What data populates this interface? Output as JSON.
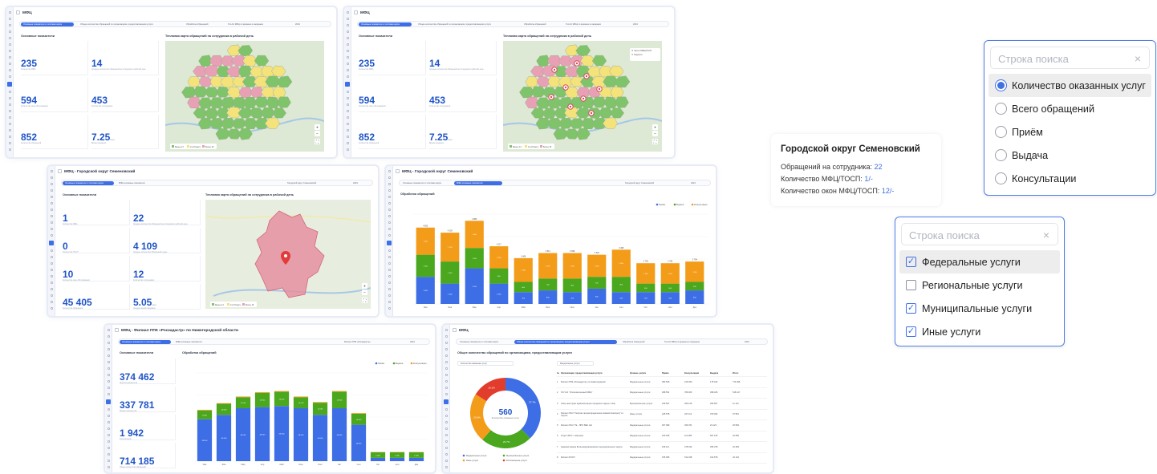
{
  "app_title": "МФЦ",
  "titles": {
    "semenovsky": "МФЦ - Городской округ Семеновский",
    "rosreestr": "МФЦ - Филиал ППК «Роскадастр» по Нижегородской области"
  },
  "tabs": {
    "main": "Основные показатели и тепловая карта",
    "services": "Общее количество обращений по организациям, предоставляющим услуги",
    "requests": "Обработка обращений",
    "top10": "Топ-10 МФЦ по времени в ожидании",
    "indicators": "МФЦ основные показатели",
    "year": "2024",
    "district": "Городской округ Семеновский",
    "branch": "Филиал ППК «Роскадастр»"
  },
  "section": {
    "indicators": "Основные показатели",
    "heatmap": "Тепловая карта обращений на сотрудника в рабочий день",
    "processing": "Обработка обращений",
    "services_total": "Общее количество обращений по организациям, предоставляющим услуги"
  },
  "kpi_region": [
    {
      "value": "235",
      "label": "Количество МФЦ"
    },
    {
      "value": "14",
      "label": "Среднее количество обращений на сотрудника в рабочий день"
    },
    {
      "value": "594",
      "label": "Количество окон обслуживания"
    },
    {
      "value": "453",
      "label": "Количество сотрудников"
    },
    {
      "value": "852",
      "label": "Количество обращений"
    },
    {
      "value": "7.25",
      "unit": "мин",
      "label": "Время ожидания"
    }
  ],
  "kpi_semenovsky": [
    {
      "value": "1",
      "label": "Количество МФЦ"
    },
    {
      "value": "22",
      "label": "Среднее количество обращений на сотрудника в рабочий день"
    },
    {
      "value": "0",
      "label": "Количество ТОСП"
    },
    {
      "value": "4 109",
      "label": "Среднее количество обращений в день"
    },
    {
      "value": "10",
      "label": "Количество окон обслуживания"
    },
    {
      "value": "12",
      "label": "Количество сотрудников"
    },
    {
      "value": "45 405",
      "label": "Количество обращений"
    },
    {
      "value": "5.05",
      "unit": "мин",
      "label": "Среднее время ожидания"
    }
  ],
  "kpi_rosreestr": [
    {
      "value": "374 462",
      "label": "Принято документов"
    },
    {
      "value": "337 781",
      "label": "Выдано документов"
    },
    {
      "value": "1 942",
      "label": "Консультации"
    },
    {
      "value": "714 185",
      "label": "Общее количество обращений"
    }
  ],
  "map_legend": [
    "Менее 13",
    "13–15 (вкл.)",
    "Более 15"
  ],
  "map_layers": [
    "Число МФЦ/ТОСП",
    "Подписи"
  ],
  "tooltip": {
    "title": "Городской округ Семеновский",
    "row1_label": "Обращений на сотрудника:",
    "row1_value": "22",
    "row2_label": "Количество МФЦ/ТОСП:",
    "row2_value": "1/-",
    "row3_label": "Количество окон МФЦ/ТОСП:",
    "row3_value": "12/-"
  },
  "radio_panel": {
    "placeholder": "Строка поиска",
    "options": [
      "Количество оказанных услуг",
      "Всего обращений",
      "Приём",
      "Выдача",
      "Консультации"
    ],
    "selected": 0
  },
  "check_panel": {
    "placeholder": "Строка поиска",
    "options": [
      "Федеральные услуги",
      "Региональные услуги",
      "Муниципальные услуги",
      "Иные услуги"
    ],
    "checked": [
      true,
      false,
      true,
      true
    ]
  },
  "chart_legend": [
    "Приём",
    "Выдача",
    "Консультация"
  ],
  "colors": {
    "accent": "#3e6ee5",
    "reception": "#3e6ee5",
    "issue": "#4aa71e",
    "consult": "#f39c19",
    "donut_red": "#e23d2c"
  },
  "chart_data": [
    {
      "type": "bar",
      "title": "Обработка обращений",
      "categories": [
        "Янв",
        "Фев",
        "Мар",
        "Апр",
        "Май",
        "Июн",
        "Июл",
        "Авг",
        "Сен",
        "Окт",
        "Ноя",
        "Дек"
      ],
      "series": [
        {
          "name": "Приём",
          "values": [
            1.6,
            1.2,
            2.1,
            1.2,
            0.7,
            0.8,
            0.7,
            0.9,
            0.7,
            0.7,
            0.7,
            0.8
          ]
        },
        {
          "name": "Выдача",
          "values": [
            1.3,
            1.3,
            1.2,
            0.9,
            0.6,
            0.7,
            0.8,
            0.7,
            0.9,
            0.5,
            0.5,
            0.5
          ]
        },
        {
          "name": "Консультация",
          "values": [
            1.6,
            1.7,
            1.6,
            1.3,
            1.4,
            1.5,
            1.5,
            1.3,
            1.6,
            1.2,
            1.2,
            1.2
          ]
        }
      ],
      "totals": [
        "4 562",
        "4 193",
        "4 880",
        "4 117",
        "3 406",
        "3 511",
        "3 598",
        "3 420",
        "3 408",
        "2 793",
        "2 783",
        "2 794"
      ]
    },
    {
      "type": "bar",
      "title": "Обработка обращений",
      "categories": [
        "Янв",
        "Фев",
        "Мар",
        "Апр",
        "Май",
        "Июн",
        "Июл",
        "Авг",
        "Сен",
        "Окт",
        "Ноя",
        "Дек"
      ],
      "series": [
        {
          "name": "Приём",
          "values": [
            38,
            42,
            48,
            49,
            50,
            48,
            42,
            48,
            33,
            3,
            3,
            3
          ]
        },
        {
          "name": "Выдача",
          "values": [
            8,
            10,
            10,
            13,
            13,
            10,
            11,
            15,
            10,
            5,
            5,
            5
          ]
        },
        {
          "name": "Консультация",
          "values": [
            0.6,
            0.6,
            0.6,
            0.6,
            0.6,
            0.6,
            0.6,
            0.6,
            0.6,
            0.3,
            0.3,
            0.3
          ]
        }
      ],
      "ylim": [
        0,
        80
      ]
    },
    {
      "type": "pie",
      "title": "Общее количество обращений по организациям, предоставляющим услуги",
      "center_value": "560",
      "center_label": "Количество оказанных услуг",
      "slices": [
        {
          "name": "Федеральные услуги",
          "value": 37.7
        },
        {
          "name": "Муниципальные услуги",
          "value": 23.7
        },
        {
          "name": "Иные услуги",
          "value": 22.6
        },
        {
          "name": "Региональные услуги",
          "value": 16.1
        }
      ],
      "labels": [
        "37.7%",
        "23.7%",
        "22.6%",
        "16.1%"
      ]
    }
  ],
  "table": {
    "headers": [
      "№",
      "Организация, предоставляющая услуги",
      "Уровень услуги",
      "Приём",
      "Консультация",
      "Выдача",
      "Итого"
    ],
    "rows": [
      [
        "1",
        "Филиал ППК «Роскадастр» по Нижегородской",
        "Федеральные услуги",
        "382 529",
        "216 450",
        "175 422",
        "774 096"
      ],
      [
        "2",
        "ГКУ НО \"Уполномоченный МФЦ\"",
        "Федеральные услуги",
        "398 551",
        "789 466",
        "398 425",
        "518 417"
      ],
      [
        "3",
        "Сбор ный орган администрации городского округа г. Бор",
        "Муниципальные услуги",
        "236 567",
        "456 125",
        "456 567",
        "11 113"
      ],
      [
        "4",
        "Филиал ПАО \"Газпром газораспределение Нижний Новгород\" в г. Сергач",
        "Иные услуги",
        "245 578",
        "347 112",
        "370 452",
        "67 561"
      ],
      [
        "5",
        "Филиал ПАО \"ГЕ - ПРО ВЕС НН",
        "Федеральные услуги",
        "367 999",
        "456 781",
        "23 123",
        "25 583"
      ],
      [
        "6",
        "Отдел ЗАГС г. Шахунья",
        "Федеральные услуги",
        "150 045",
        "112 385",
        "567 125",
        "22 656"
      ],
      [
        "7",
        "Администрация Большемурашкинского муниципального округа",
        "Федеральные услуги",
        "196 111",
        "478 432",
        "456 378",
        "22 465"
      ],
      [
        "8",
        "Филиал РОСП",
        "Федеральные услуги",
        "155 095",
        "512 438",
        "312 678",
        "22 143"
      ]
    ]
  }
}
